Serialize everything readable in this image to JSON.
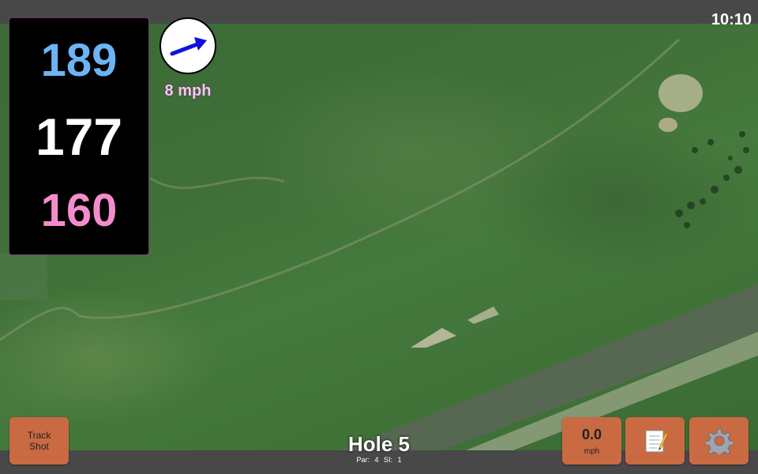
{
  "status_bar": {
    "time": "10:10"
  },
  "yardages": {
    "back": "189",
    "middle": "177",
    "front": "160"
  },
  "wind": {
    "speed": "8 mph",
    "icon": "arrow-icon",
    "arrow_color": "#1010e0"
  },
  "buttons": {
    "track_shot": "Track\nShot",
    "speed_value": "0.0",
    "speed_unit": "mph",
    "notes_icon": "notepad-icon",
    "settings_icon": "gear-icon"
  },
  "hole": {
    "title": "Hole 5",
    "subtitle": "Par: 4   SI: 1"
  },
  "colors": {
    "button": "#c96a42",
    "back": "#6cb4f4",
    "front": "#f48ccc",
    "panel": "#000000"
  }
}
